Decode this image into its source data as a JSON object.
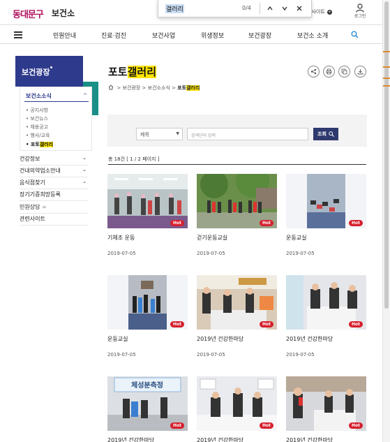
{
  "header": {
    "logo_text": "동대문구",
    "site_name": "보건소",
    "external_link": "모사이트",
    "login_label": "로그인"
  },
  "find_bar": {
    "query": "갤러리",
    "match_count": "0/4"
  },
  "nav": {
    "items": [
      "민원안내",
      "진료·검진",
      "보건사업",
      "위생정보",
      "보건광장",
      "보건소 소개"
    ]
  },
  "sidebar": {
    "heading": "보건광장",
    "submenu_title": "보건소소식",
    "submenu_items": [
      "공지사항",
      "보건뉴스",
      "채용공고",
      "행사/교육"
    ],
    "active_item_prefix": "포토",
    "active_item_highlight": "갤러리",
    "menu_items": [
      "건강정보",
      "건내의약업소안내",
      "음식점찾기",
      "장기기증희망등록",
      "민원상담",
      "관련사이트"
    ]
  },
  "content": {
    "title_prefix": "포토",
    "title_highlight": "갤러리",
    "breadcrumb": [
      "보건광장",
      "보건소소식",
      "포토"
    ],
    "breadcrumb_highlight": "갤러리",
    "search": {
      "select_value": "제목",
      "placeholder": "검색단어 입력",
      "button_label": "조회"
    },
    "total_text": "총 18건 [ 1 / 2 페이지 ]",
    "hot_badge": "Hot",
    "cards": [
      {
        "title": "기체조 운동",
        "date": "2019-07-05"
      },
      {
        "title": "걷기운동교실",
        "date": "2019-07-05"
      },
      {
        "title": "운동교실",
        "date": "2019-07-05"
      },
      {
        "title": "운동교실",
        "date": "2019-07-05"
      },
      {
        "title": "2019년 건강한마당",
        "date": "2019-07-05"
      },
      {
        "title": "2019년 건강한마당",
        "date": "2019-07-05"
      },
      {
        "title": "2019년 건강한마당",
        "date": ""
      },
      {
        "title": "2019년 건강한마당",
        "date": ""
      },
      {
        "title": "2019년 건강한마당",
        "date": ""
      }
    ],
    "photo_sign_text": "체성분측정"
  },
  "colors": {
    "primary": "#2e3a8c",
    "accent_teal": "#1a8f88",
    "hot_red": "#d61f2d",
    "logo": "#b0145f",
    "highlight": "#ffe600"
  }
}
